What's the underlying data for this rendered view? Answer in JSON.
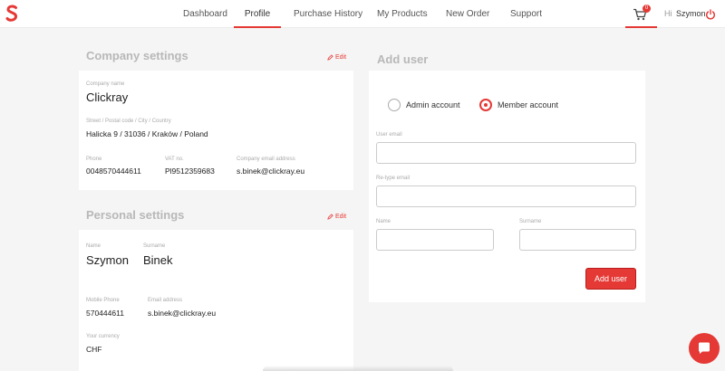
{
  "nav": {
    "items": [
      {
        "label": "Dashboard"
      },
      {
        "label": "Profile"
      },
      {
        "label": "Purchase History"
      },
      {
        "label": "My Products"
      },
      {
        "label": "New Order"
      },
      {
        "label": "Support"
      }
    ],
    "active": "Profile",
    "cart_count": "0",
    "greeting": "Hi",
    "user_name": "Szymon"
  },
  "company": {
    "title": "Company settings",
    "edit_label": "Edit",
    "name_label": "Company name",
    "name_value": "Clickray",
    "address_label": "Street / Postal code / City / Country",
    "address_value": "Halicka 9 / 31036 / Kraków / Poland",
    "phone_label": "Phone",
    "phone_value": "0048570444611",
    "vat_label": "VAT no.",
    "vat_value": "Pl9512359683",
    "email_label": "Company email address",
    "email_value": "s.binek@clickray.eu"
  },
  "personal": {
    "title": "Personal settings",
    "edit_label": "Edit",
    "name_label": "Name",
    "name_value": "Szymon",
    "surname_label": "Surname",
    "surname_value": "Binek",
    "phone_label": "Mobile Phone",
    "phone_value": "570444611",
    "email_label": "Email address",
    "email_value": "s.binek@clickray.eu",
    "currency_label": "Your currency",
    "currency_value": "CHF"
  },
  "add_user": {
    "title": "Add user",
    "admin_label": "Admin account",
    "member_label": "Member account",
    "selected": "member",
    "email_label": "User email",
    "email_value": "",
    "retype_label": "Re-type email",
    "retype_value": "",
    "name_label": "Name",
    "name_value": "",
    "surname_label": "Surname",
    "surname_value": "",
    "button_label": "Add user"
  },
  "colors": {
    "accent": "#e53935",
    "muted_title": "#b8b8b8"
  }
}
